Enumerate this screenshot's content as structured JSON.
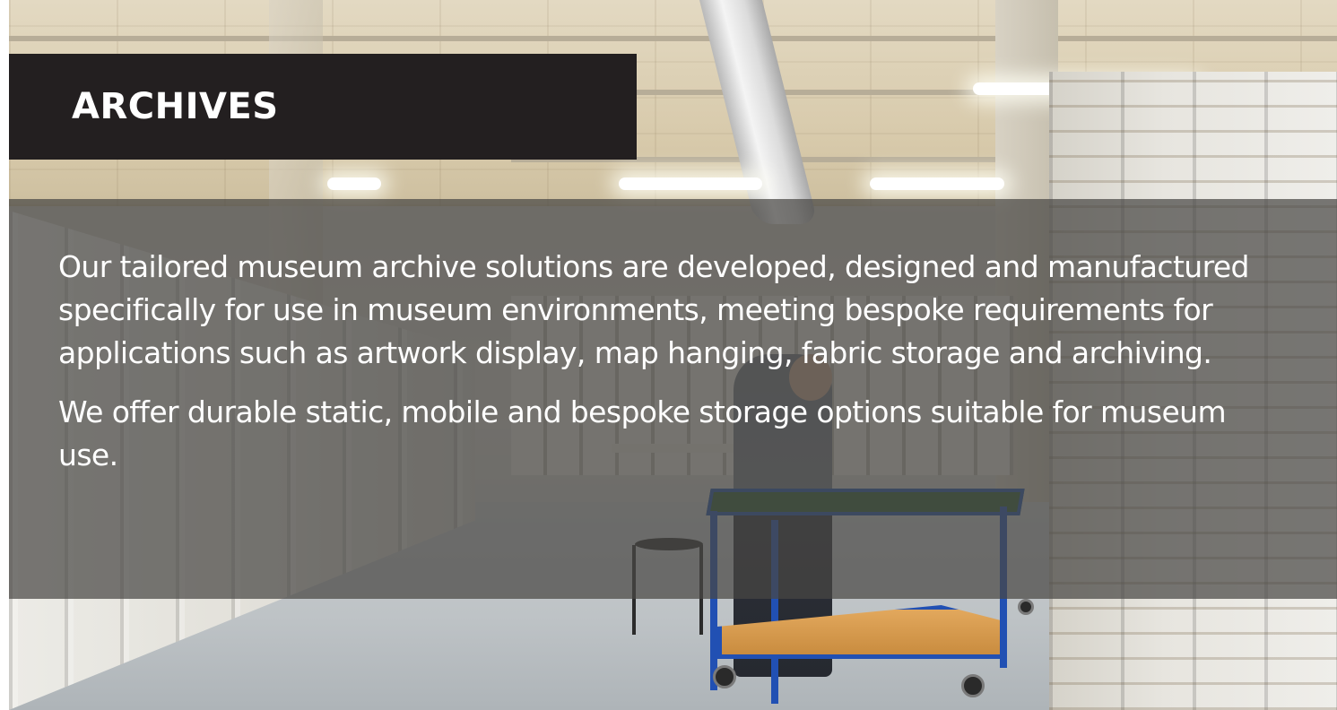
{
  "hero": {
    "title": "ARCHIVES",
    "paragraphs": [
      "Our tailored museum archive solutions are developed, designed and manufactured specifically for use in museum environments, meeting bespoke requirements for applications such as artwork display, map hanging, fabric storage and archiving.",
      "We offer durable static, mobile and bespoke storage options suitable for museum use."
    ]
  },
  "colors": {
    "title_bar": "#231f20",
    "text_panel": "rgba(72,70,68,0.72)",
    "text": "#ffffff"
  }
}
